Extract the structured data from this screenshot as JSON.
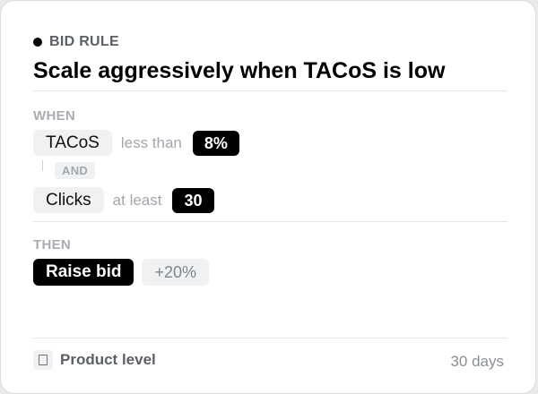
{
  "card": {
    "eyebrow": "BID RULE",
    "title": "Scale aggressively when TACoS is low"
  },
  "when": {
    "label": "WHEN",
    "conditions": [
      {
        "metric": "TACoS",
        "operator": "less than",
        "value": "8%"
      },
      {
        "metric": "Clicks",
        "operator": "at least",
        "value": "30"
      }
    ],
    "joiner": "AND"
  },
  "then": {
    "label": "THEN",
    "action": "Raise bid",
    "amount": "+20%"
  },
  "footer": {
    "icon": "box-icon",
    "scope": "Product level",
    "window": "30 days"
  }
}
